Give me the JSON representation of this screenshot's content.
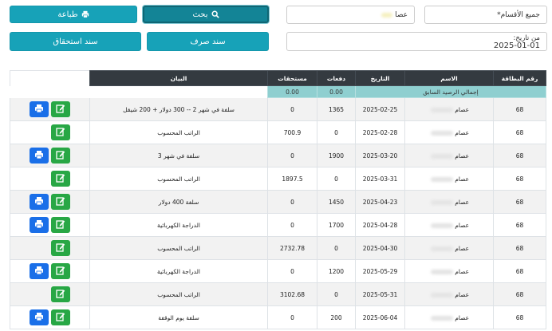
{
  "filters": {
    "department": "جميع الأقسام*",
    "employee": "عصا",
    "from_label": "من تاريخ:",
    "from_value": "2025-01-01"
  },
  "buttons": {
    "search": "بحث",
    "print": "طباعة",
    "payment_voucher": "سند صرف",
    "entitlement_voucher": "سند استحقاق"
  },
  "table": {
    "headers": [
      "رقم البطاقة",
      "الاسم",
      "التاريخ",
      "دفعات",
      "مستحقات",
      "البيان"
    ],
    "summary": {
      "label": "إجمالي الرصيد السابق",
      "payments": "0.00",
      "dues": "0.00"
    },
    "rows": [
      {
        "card": "68",
        "name": "عصام",
        "date": "2025-02-25",
        "pay": "1365",
        "due": "0",
        "desc": "سلفة في شهر 2 -- 300 دولار + 200 شيقل",
        "print": true
      },
      {
        "card": "68",
        "name": "عصام",
        "date": "2025-02-28",
        "pay": "0",
        "due": "700.9",
        "desc": "الراتب المحسوب",
        "print": false
      },
      {
        "card": "68",
        "name": "عصام",
        "date": "2025-03-20",
        "pay": "1900",
        "due": "0",
        "desc": "سلفة في شهر 3",
        "print": true
      },
      {
        "card": "68",
        "name": "عصام",
        "date": "2025-03-31",
        "pay": "0",
        "due": "1897.5",
        "desc": "الراتب المحسوب",
        "print": false
      },
      {
        "card": "68",
        "name": "عصام",
        "date": "2025-04-23",
        "pay": "1450",
        "due": "0",
        "desc": "سلفة 400 دولار",
        "print": true
      },
      {
        "card": "68",
        "name": "عصام",
        "date": "2025-04-28",
        "pay": "1700",
        "due": "0",
        "desc": "الدراجة الكهربائية",
        "print": true
      },
      {
        "card": "68",
        "name": "عصام",
        "date": "2025-04-30",
        "pay": "0",
        "due": "2732.78",
        "desc": "الراتب المحسوب",
        "print": false
      },
      {
        "card": "68",
        "name": "عصام",
        "date": "2025-05-29",
        "pay": "1200",
        "due": "0",
        "desc": "الدراجة الكهربائية",
        "print": true
      },
      {
        "card": "68",
        "name": "عصام",
        "date": "2025-05-31",
        "pay": "0",
        "due": "3102.68",
        "desc": "الراتب المحسوب",
        "print": false
      },
      {
        "card": "68",
        "name": "عصام",
        "date": "2025-06-04",
        "pay": "200",
        "due": "0",
        "desc": "سلفة يوم الوقفة",
        "print": true
      }
    ]
  }
}
